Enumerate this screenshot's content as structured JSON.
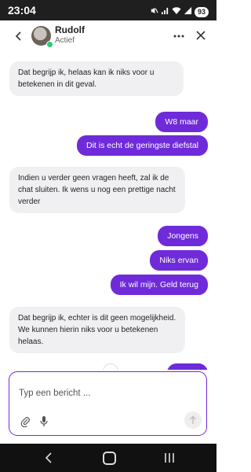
{
  "status_bar": {
    "time": "23:04",
    "battery": "93"
  },
  "header": {
    "contact_name": "Rudolf",
    "contact_status": "Actief"
  },
  "messages": [
    {
      "from": "agent",
      "text": "Dat begrijp ik, helaas kan ik niks voor u betekenen in dit geval."
    },
    {
      "from": "user",
      "text": "W8 maar"
    },
    {
      "from": "user",
      "text": "Dit is echt de geringste diefstal"
    },
    {
      "from": "agent",
      "text": "Indien u verder geen vragen heeft, zal ik de chat sluiten. Ik wens u nog een prettige nacht verder"
    },
    {
      "from": "user",
      "text": "Jongens"
    },
    {
      "from": "user",
      "text": "Niks ervan"
    },
    {
      "from": "user",
      "text": "Ik wil mijn. Geld terug"
    },
    {
      "from": "agent",
      "text": "Dat begrijp ik, echter is dit geen mogelijkheid. We kunnen hierin niks voor u betekenen helaas."
    }
  ],
  "composer": {
    "placeholder": "Typ een bericht ..."
  },
  "colors": {
    "accent": "#6f2bd9",
    "incoming_bubble": "#f0f0f2",
    "online": "#2ecc71"
  },
  "icons": [
    "back-arrow-icon",
    "more-icon",
    "close-icon",
    "chevron-down-icon",
    "paperclip-icon",
    "microphone-icon",
    "send-arrow-icon"
  ]
}
